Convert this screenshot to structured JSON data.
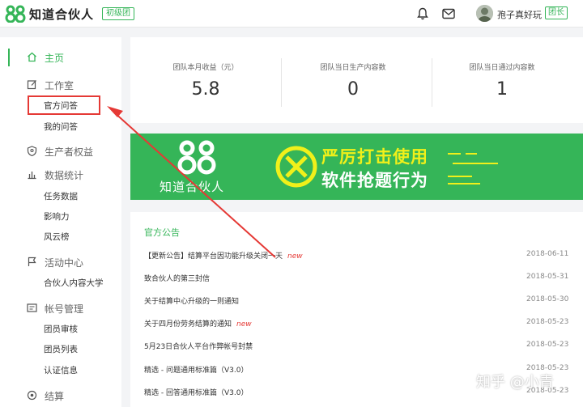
{
  "header": {
    "app_title": "知道合伙人",
    "level_badge": "初级团",
    "username": "孢子真好玩",
    "role_badge": "团长"
  },
  "sidebar": {
    "home": "主页",
    "studio": "工作室",
    "studio_items": [
      "官方问答",
      "我的问答"
    ],
    "producer_rights": "生产者权益",
    "data_stats": "数据统计",
    "data_items": [
      "任务数据",
      "影响力",
      "风云榜"
    ],
    "activity_center": "活动中心",
    "activity_items": [
      "合伙人内容大学"
    ],
    "account_mgmt": "帐号管理",
    "account_items": [
      "团员审核",
      "团员列表",
      "认证信息"
    ],
    "settlement": "结算"
  },
  "stats": [
    {
      "label": "团队本月收益（元）",
      "value": "5.8"
    },
    {
      "label": "团队当日生产内容数",
      "value": "0"
    },
    {
      "label": "团队当日通过内容数",
      "value": "1"
    }
  ],
  "banner": {
    "brand": "知道合伙人",
    "line1": "严厉打击使用",
    "line2": "软件抢题行为"
  },
  "announcements": {
    "title": "官方公告",
    "new_label": "new",
    "items": [
      {
        "text": "【更新公告】结算平台因功能升级关闭一天",
        "is_new": true,
        "date": "2018-06-11"
      },
      {
        "text": "致合伙人的第三封信",
        "is_new": false,
        "date": "2018-05-31"
      },
      {
        "text": "关于结算中心升级的一则通知",
        "is_new": false,
        "date": "2018-05-30"
      },
      {
        "text": "关于四月份劳务结算的通知",
        "is_new": true,
        "date": "2018-05-23"
      },
      {
        "text": "5月23日合伙人平台作弊帐号封禁",
        "is_new": false,
        "date": "2018-05-23"
      },
      {
        "text": "精选 - 问题通用标准篇（V3.0）",
        "is_new": false,
        "date": "2018-05-23"
      },
      {
        "text": "精选 - 回答通用标准篇（V3.0）",
        "is_new": false,
        "date": "2018-05-23"
      }
    ]
  },
  "watermark": "知乎 @小青",
  "colors": {
    "accent": "#35b558",
    "annotation": "#e53935",
    "banner_highlight": "#f0f01a"
  }
}
